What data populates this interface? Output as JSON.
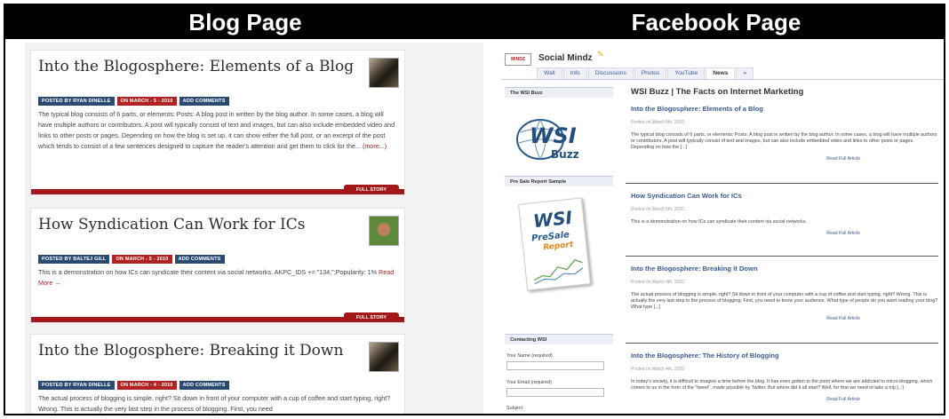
{
  "headers": {
    "left": "Blog Page",
    "right": "Facebook Page"
  },
  "blog": {
    "posts": [
      {
        "title": "Into the Blogosphere: Elements of a Blog",
        "author": "POSTED BY RYAN DINELLE",
        "date": "ON MARCH - 5 - 2010",
        "comments": "ADD COMMENTS",
        "excerpt": "The typical blog consists of 6 parts, or elements: Posts: A blog post in written by the blog author. In some cases, a blog will have multiple authors or contributors. A post will typically consist of text and images, but can also include embedded video and links to other posts or pages. Depending on how the blog is set up, it can show either the full post, or an excerpt of the post which tends to consist of a few sentences designed to capture the reader's attention and get them to click for the...",
        "more": "(more...)",
        "full": "FULL STORY"
      },
      {
        "title": "How Syndication Can Work for ICs",
        "author": "POSTED BY BALTEJ GILL",
        "date": "ON MARCH - 5 - 2010",
        "comments": "ADD COMMENTS",
        "excerpt": "This is a demonstration on how ICs can syndicate their content via social networks. AKPC_IDS += \"134,\";Popularity: 1%",
        "more": "Read More →",
        "full": "FULL STORY"
      },
      {
        "title": "Into the Blogosphere: Breaking it Down",
        "author": "POSTED BY RYAN DINELLE",
        "date": "ON MARCH - 4 - 2010",
        "comments": "ADD COMMENTS",
        "excerpt": "The actual process of blogging is simple, right? Sit down in front of your computer with a cup of coffee and start typing, right? Wrong. This is actually the very last step in the process of blogging. First, you need",
        "more": "",
        "full": ""
      }
    ]
  },
  "facebook": {
    "logo_text": "MINDZ",
    "page_name": "Social Mindz",
    "tabs": [
      "Wall",
      "Info",
      "Discussions",
      "Photos",
      "YouTube",
      "News",
      "»"
    ],
    "active_tab": "News",
    "sidebar": {
      "buzz_head": "The WSI Buzz",
      "buzz_logo_top": "WSI",
      "buzz_logo_sub": "Buzz",
      "presale_head": "Pre Sale Report Sample",
      "presale_wsi": "WSI",
      "presale_pre": "PreSale",
      "presale_report": "Report",
      "contact_head": "Contacting WSI",
      "name_label": "Your Name (required)",
      "email_label": "Your Email (required)",
      "subject_label": "Subject"
    },
    "main_heading": "WSI Buzz | The Facts on Internet Marketing",
    "posts": [
      {
        "title": "Into the Blogosphere: Elements of a Blog",
        "date": "Posted on March 5th, 2010",
        "excerpt": "The typical blog consists of 6 parts, or elements: Posts: A blog post in written by the blog author. In some cases, a blog will have multiple authors or contributors. A post will typically consist of text and images, but can also include embedded video and links to other posts or pages. Depending on how the [...]",
        "read": "Read Full Article"
      },
      {
        "title": "How Syndication Can Work for ICs",
        "date": "Posted on March 5th, 2010",
        "excerpt": "This is a demonstration on how ICs can syndicate their content via social networks.",
        "read": "Read Full Article"
      },
      {
        "title": "Into the Blogosphere: Breaking it Down",
        "date": "Posted on March 4th, 2010",
        "excerpt": "The actual process of blogging is simple, right? Sit down in front of your computer with a cup of coffee and start typing, right? Wrong. This is actually the very last step in the process of blogging. First, you need to know your audience. What type of people do you want reading your blog? What type [...]",
        "read": "Read Full Article"
      },
      {
        "title": "Into the Blogosphere: The History of Blogging",
        "date": "Posted on March 4th, 2010",
        "excerpt": "In today's society, it is difficult to imagine a time before the blog. It has even gotten to the point where we are addicted to micro-blogging, which comes to us in the form of the \"tweet\", made possible by Twitter. But where did it all start? Well, for that we need to take a trip [...]",
        "read": "Read Full Article"
      }
    ]
  }
}
